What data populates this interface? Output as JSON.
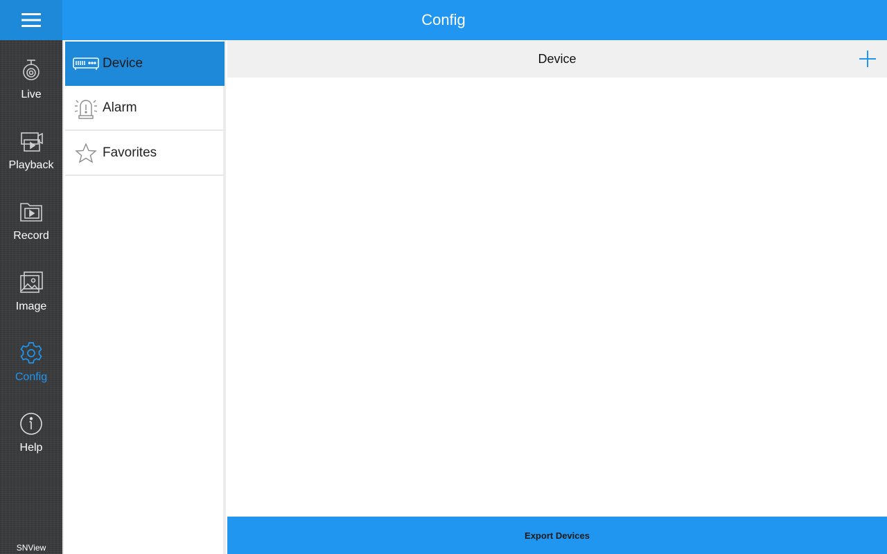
{
  "header": {
    "title": "Config",
    "menu_icon": "hamburger-icon"
  },
  "sidebar": {
    "items": [
      {
        "label": "Live",
        "icon": "camera-icon",
        "active": false
      },
      {
        "label": "Playback",
        "icon": "playback-icon",
        "active": false
      },
      {
        "label": "Record",
        "icon": "record-folder-icon",
        "active": false
      },
      {
        "label": "Image",
        "icon": "image-icon",
        "active": false
      },
      {
        "label": "Config",
        "icon": "gear-icon",
        "active": true
      },
      {
        "label": "Help",
        "icon": "info-icon",
        "active": false
      }
    ],
    "brand": "SNView"
  },
  "submenu": {
    "items": [
      {
        "label": "Device",
        "icon": "dvr-device-icon",
        "active": true
      },
      {
        "label": "Alarm",
        "icon": "alarm-light-icon",
        "active": false
      },
      {
        "label": "Favorites",
        "icon": "star-icon",
        "active": false
      }
    ]
  },
  "content": {
    "title": "Device",
    "add_icon": "plus-icon"
  },
  "footer": {
    "export_label": "Export Devices"
  },
  "colors": {
    "accent": "#2196f0",
    "accent_dark": "#1e88d9",
    "sidebar_bg": "#3a3c3e",
    "header_bar": "#f0f0f0"
  }
}
